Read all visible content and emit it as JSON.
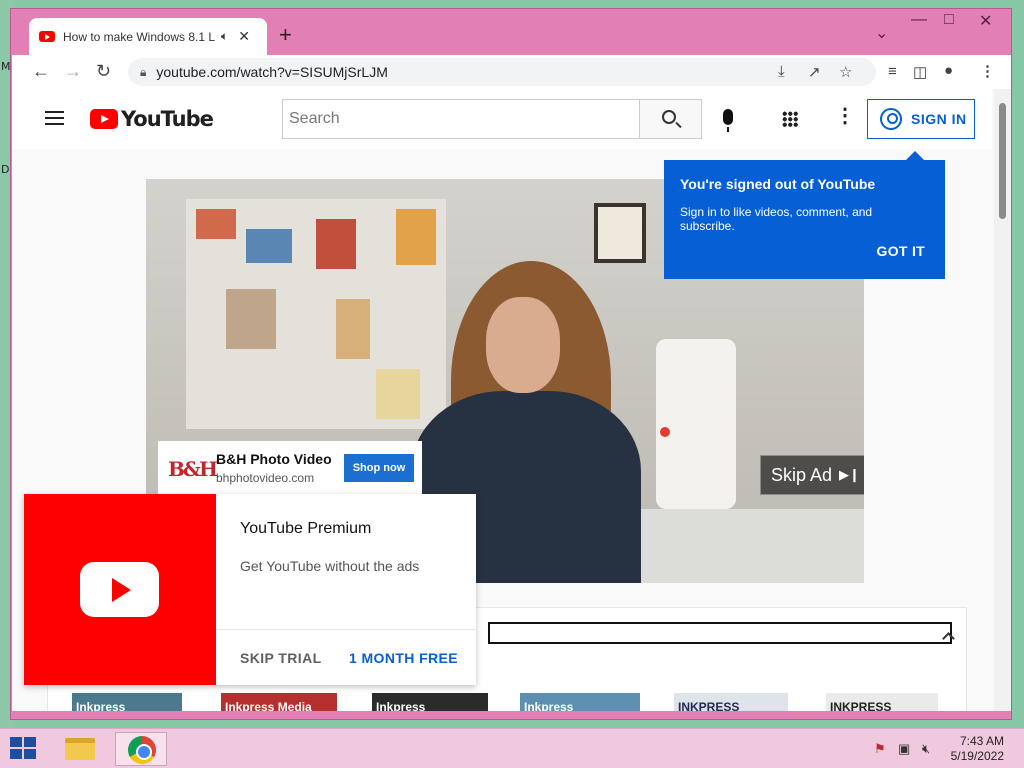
{
  "browser": {
    "tab_title": "How to make Windows 8.1 L",
    "new_tab": "+",
    "url": "youtube.com/watch?v=SISUMjSrLJM"
  },
  "youtube": {
    "logo_text": "YouTube",
    "search_placeholder": "Search",
    "sign_in_label": "SIGN IN"
  },
  "tooltip": {
    "title": "You're signed out of YouTube",
    "body": "Sign in to like videos, comment, and subscribe.",
    "button": "GOT IT"
  },
  "ad": {
    "logo": "B&H",
    "name": "B&H Photo Video",
    "domain": "bhphotovideo.com",
    "cta": "Shop now",
    "skip": "Skip Ad"
  },
  "promo": {
    "title": "YouTube Premium",
    "description": "Get YouTube without the ads",
    "skip_button": "SKIP TRIAL",
    "trial_button": "1 MONTH FREE"
  },
  "thumbnails": [
    "Inkpress",
    "Inkpress Media",
    "Inkpress",
    "Inkpress",
    "INKPRESS",
    "INKPRESS"
  ],
  "taskbar": {
    "time": "7:43 AM",
    "date": "5/19/2022"
  },
  "colors": {
    "window_frame": "#e27fb4",
    "youtube_red": "#ff0000",
    "youtube_blue": "#065fd4",
    "taskbar": "#f0c9df"
  },
  "icons": [
    "speaker-icon",
    "close-icon",
    "back-icon",
    "forward-icon",
    "reload-icon",
    "lock-icon",
    "download-icon",
    "share-icon",
    "star-icon",
    "playlist-icon",
    "side-panel-icon",
    "profile-icon",
    "menu-icon",
    "search-icon",
    "mic-icon",
    "apps-icon",
    "more-icon",
    "account-icon",
    "skip-icon",
    "chevron-up-icon",
    "windows-start-icon",
    "file-explorer-icon",
    "chrome-icon",
    "flag-icon",
    "network-icon",
    "volume-muted-icon"
  ]
}
